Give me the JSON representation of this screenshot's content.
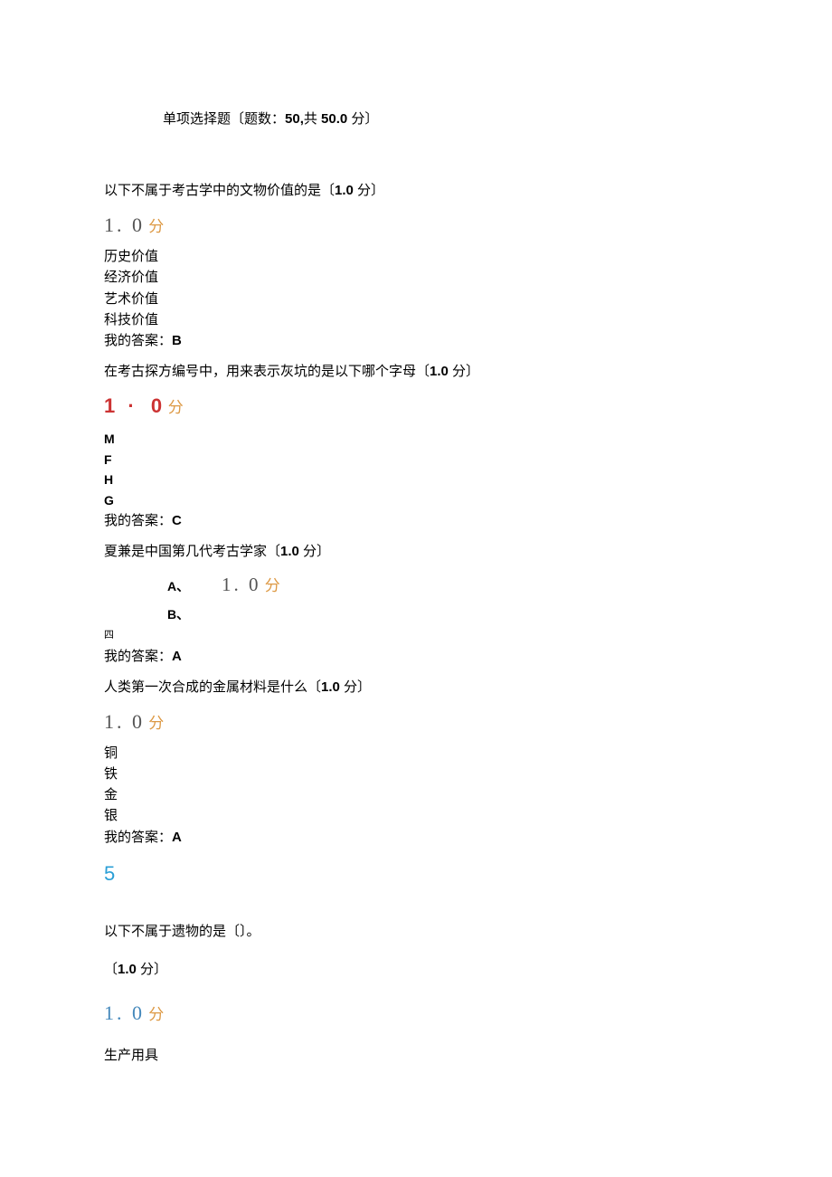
{
  "section": {
    "title_prefix": "单项选择题〔题数：",
    "count": "50,",
    "total_prefix": "共 ",
    "total": "50.0",
    "suffix": " 分〕"
  },
  "q1": {
    "text": "以下不属于考古学中的文物价值的是〔",
    "pts": "1.0",
    "pts_suffix": " 分〕",
    "score_num": "1. 0",
    "score_fen": " 分",
    "opt_a": "历史价值",
    "opt_b": "经济价值",
    "opt_c": "艺术价值",
    "opt_d": "科技价值",
    "answer_label": "我的答案：",
    "answer": "B"
  },
  "q2": {
    "text": "在考古探方编号中，用来表示灰坑的是以下哪个字母〔",
    "pts": "1.0",
    "pts_suffix": " 分〕",
    "score_num_a": "1",
    "score_dot": " · ",
    "score_num_b": "0",
    "score_fen": " 分",
    "opt_a": "M",
    "opt_b": "F",
    "opt_c": "H",
    "opt_d": "G",
    "answer_label": "我的答案：",
    "answer": "C"
  },
  "q3": {
    "text": "夏兼是中国第几代考古学家〔",
    "pts": "1.0",
    "pts_suffix": " 分〕",
    "row_a": "A、",
    "inline_score": "1. 0",
    "inline_fen": " 分",
    "row_b": "B、",
    "opt_four": "四",
    "answer_label": "我的答案：",
    "answer": "A"
  },
  "q4": {
    "text": "人类第一次合成的金属材料是什么〔",
    "pts": "1.0",
    "pts_suffix": " 分〕",
    "score_num": "1. 0",
    "score_fen": " 分",
    "opt_a": "铜",
    "opt_b": "铁",
    "opt_c": "金",
    "opt_d": "银",
    "answer_label": "我的答案：",
    "answer": "A"
  },
  "q5": {
    "number": "5",
    "text": "以下不属于遗物的是〔〕。",
    "pts_open": "〔",
    "pts": "1.0",
    "pts_suffix": " 分〕",
    "score_num": "1. 0",
    "score_fen": " 分",
    "opt_a": "生产用具"
  }
}
